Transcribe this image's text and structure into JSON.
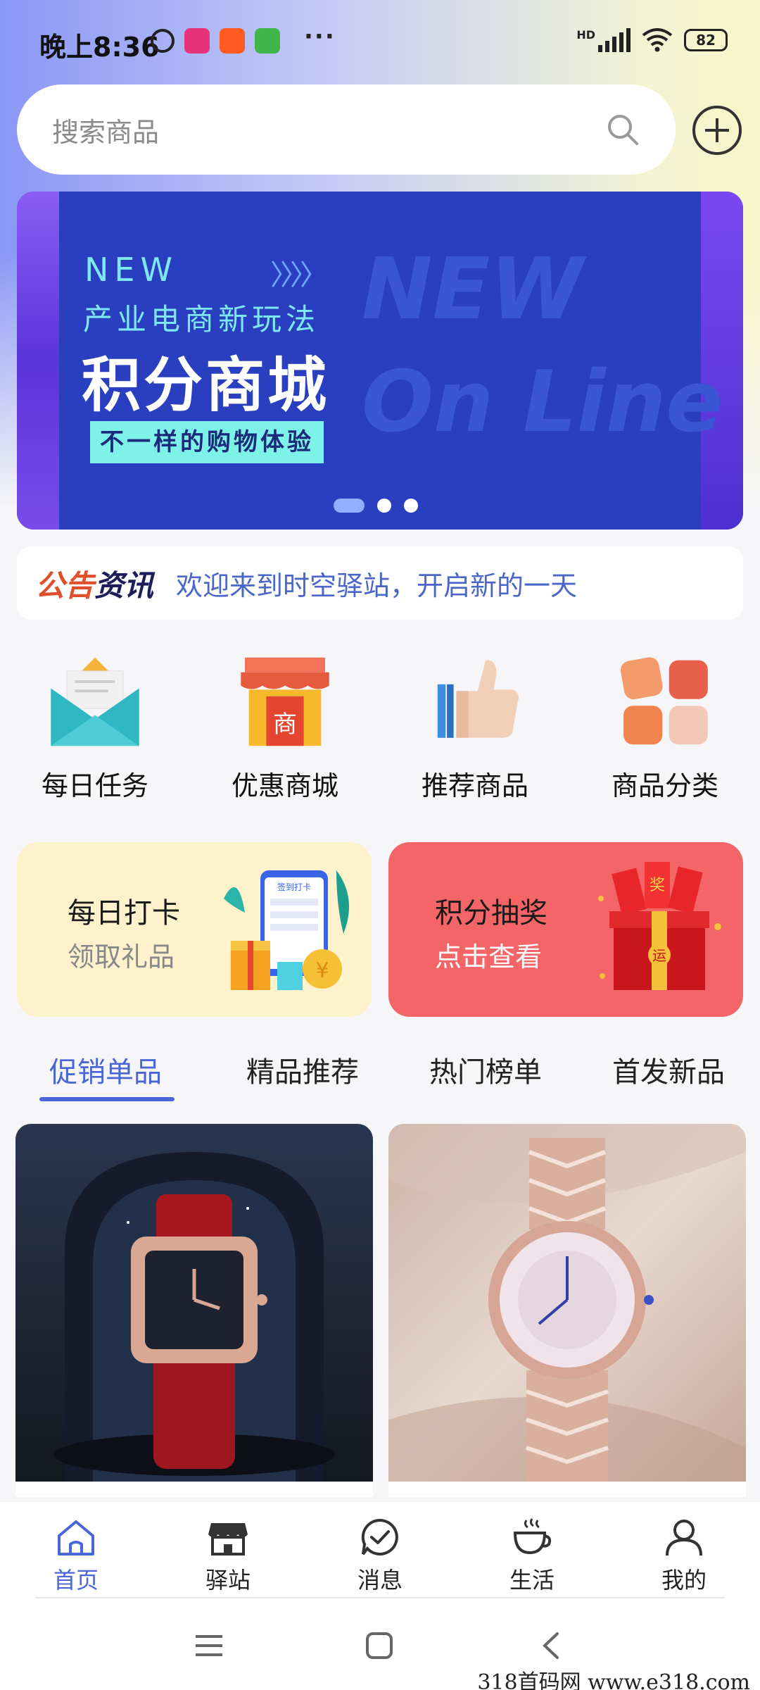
{
  "status_bar": {
    "time": "晚上8:36",
    "more": "···",
    "network": "HD",
    "battery": "82"
  },
  "search": {
    "placeholder": "搜索商品"
  },
  "banner": {
    "new_label": "NEW",
    "arrows": "〉〉〉〉",
    "subtitle": "产业电商新玩法",
    "title": "积分商城",
    "tagline": "不一样的购物体验",
    "bg_line1": "NEW",
    "bg_line2": "On Line",
    "slide_count": 3,
    "active_slide": 1
  },
  "notice": {
    "tag_part1": "公告",
    "tag_part2": "资讯",
    "text": "欢迎来到时空驿站，开启新的一天"
  },
  "quick_links": [
    {
      "label": "每日任务",
      "icon": "envelope-icon"
    },
    {
      "label": "优惠商城",
      "icon": "shop-icon"
    },
    {
      "label": "推荐商品",
      "icon": "thumbs-up-icon"
    },
    {
      "label": "商品分类",
      "icon": "category-grid-icon"
    }
  ],
  "cards": {
    "checkin": {
      "title": "每日打卡",
      "subtitle": "领取礼品",
      "color": "#fdf2cc",
      "art_text": "签到打卡"
    },
    "lottery": {
      "title": "积分抽奖",
      "subtitle": "点击查看",
      "color": "#f46567",
      "art_text_1": "奖",
      "art_text_2": "运"
    }
  },
  "tabs": [
    {
      "label": "促销单品",
      "active": true
    },
    {
      "label": "精品推荐",
      "active": false
    },
    {
      "label": "热门榜单",
      "active": false
    },
    {
      "label": "首发新品",
      "active": false
    }
  ],
  "products": [
    {
      "image": "square-watch-red-strap"
    },
    {
      "image": "rose-gold-diamond-watch"
    }
  ],
  "bottom_nav": [
    {
      "label": "首页",
      "icon": "home-icon",
      "active": true
    },
    {
      "label": "驿站",
      "icon": "store-icon",
      "active": false
    },
    {
      "label": "消息",
      "icon": "message-check-icon",
      "active": false
    },
    {
      "label": "生活",
      "icon": "coffee-cup-icon",
      "active": false
    },
    {
      "label": "我的",
      "icon": "user-icon",
      "active": false
    }
  ],
  "watermark": "318首码网  www.e318.com",
  "colors": {
    "accent": "#4a66d6",
    "notice_red": "#e04f2c",
    "lottery_card": "#f46567",
    "checkin_card": "#fdf2cc"
  }
}
